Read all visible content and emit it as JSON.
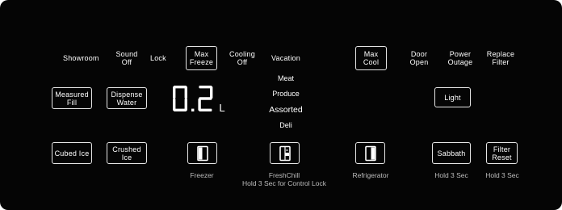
{
  "top_labels": {
    "showroom": "Showroom",
    "sound_off": "Sound Off",
    "lock": "Lock",
    "cooling_off": "Cooling Off",
    "vacation": "Vacation",
    "door_open": "Door Open",
    "power_outage": "Power Outage",
    "replace_filter": "Replace Filter"
  },
  "buttons": {
    "max_freeze": "Max Freeze",
    "max_cool": "Max Cool",
    "measured_fill": "Measured Fill",
    "dispense_water": "Dispense Water",
    "light": "Light",
    "cubed_ice": "Cubed Ice",
    "crushed_ice": "Crushed Ice",
    "sabbath": "Sabbath",
    "filter_reset": "Filter Reset"
  },
  "display": {
    "value": "0.2",
    "unit": "L"
  },
  "freshchill_modes": [
    "Meat",
    "Produce",
    "Assorted",
    "Deli"
  ],
  "selected_mode": "Assorted",
  "captions": {
    "freezer": "Freezer",
    "freshchill": "FreshChill",
    "freshchill_hold": "Hold 3 Sec for Control Lock",
    "refrigerator": "Refrigerator",
    "sabbath_hold": "Hold 3 Sec",
    "filter_hold": "Hold 3 Sec"
  },
  "colors": {
    "panel": "#050505",
    "text": "#ffffff",
    "caption": "#bdbdbd",
    "border": "#e6e6e6"
  }
}
